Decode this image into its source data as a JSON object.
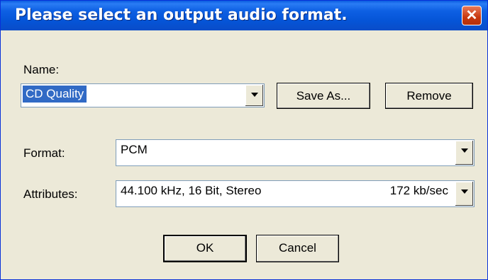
{
  "window": {
    "title": "Please select an output audio format.",
    "close_icon": "close-icon"
  },
  "name": {
    "label": "Name:",
    "value": "CD Quality",
    "save_as": "Save As...",
    "remove": "Remove"
  },
  "format": {
    "label": "Format:",
    "value": "PCM"
  },
  "attributes": {
    "label": "Attributes:",
    "value": "44.100 kHz, 16 Bit, Stereo",
    "rate": "172 kb/sec"
  },
  "actions": {
    "ok": "OK",
    "cancel": "Cancel"
  },
  "colors": {
    "titlebar": "#0554d6",
    "selection": "#316ac5",
    "close": "#c8380f",
    "dialog": "#ece9d8"
  }
}
